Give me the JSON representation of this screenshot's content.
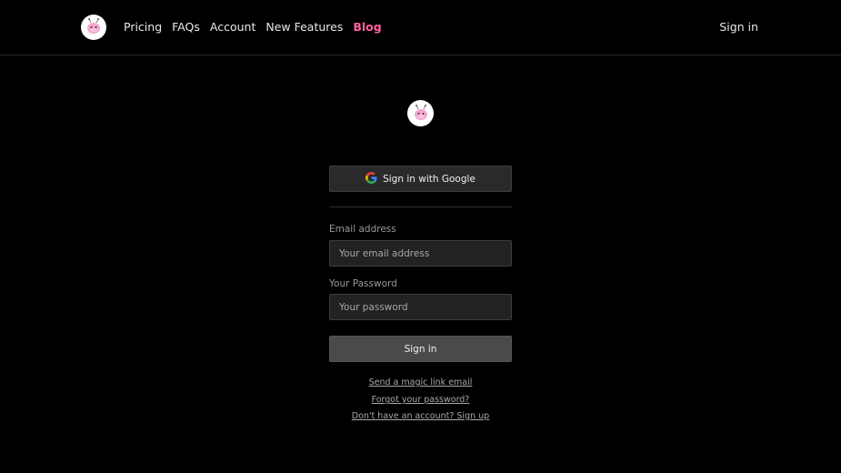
{
  "nav": {
    "logo_icon": "robot-mascot-icon",
    "links": [
      {
        "label": "Pricing"
      },
      {
        "label": "FAQs"
      },
      {
        "label": "Account"
      },
      {
        "label": "New Features"
      },
      {
        "label": "Blog",
        "active": true
      }
    ],
    "sign_in": "Sign in"
  },
  "auth": {
    "logo_icon": "robot-mascot-icon",
    "google_button": "Sign in with Google",
    "email_label": "Email address",
    "email_placeholder": "Your email address",
    "email_value": "",
    "password_label": "Your Password",
    "password_placeholder": "Your password",
    "password_value": "",
    "submit": "Sign in",
    "magic_link": "Send a magic link email",
    "forgot_password": "Forgot your password?",
    "sign_up": "Don't have an account? Sign up"
  },
  "colors": {
    "background": "#000000",
    "accent": "#ff5fa2",
    "mascot": "#f4a6cf"
  }
}
